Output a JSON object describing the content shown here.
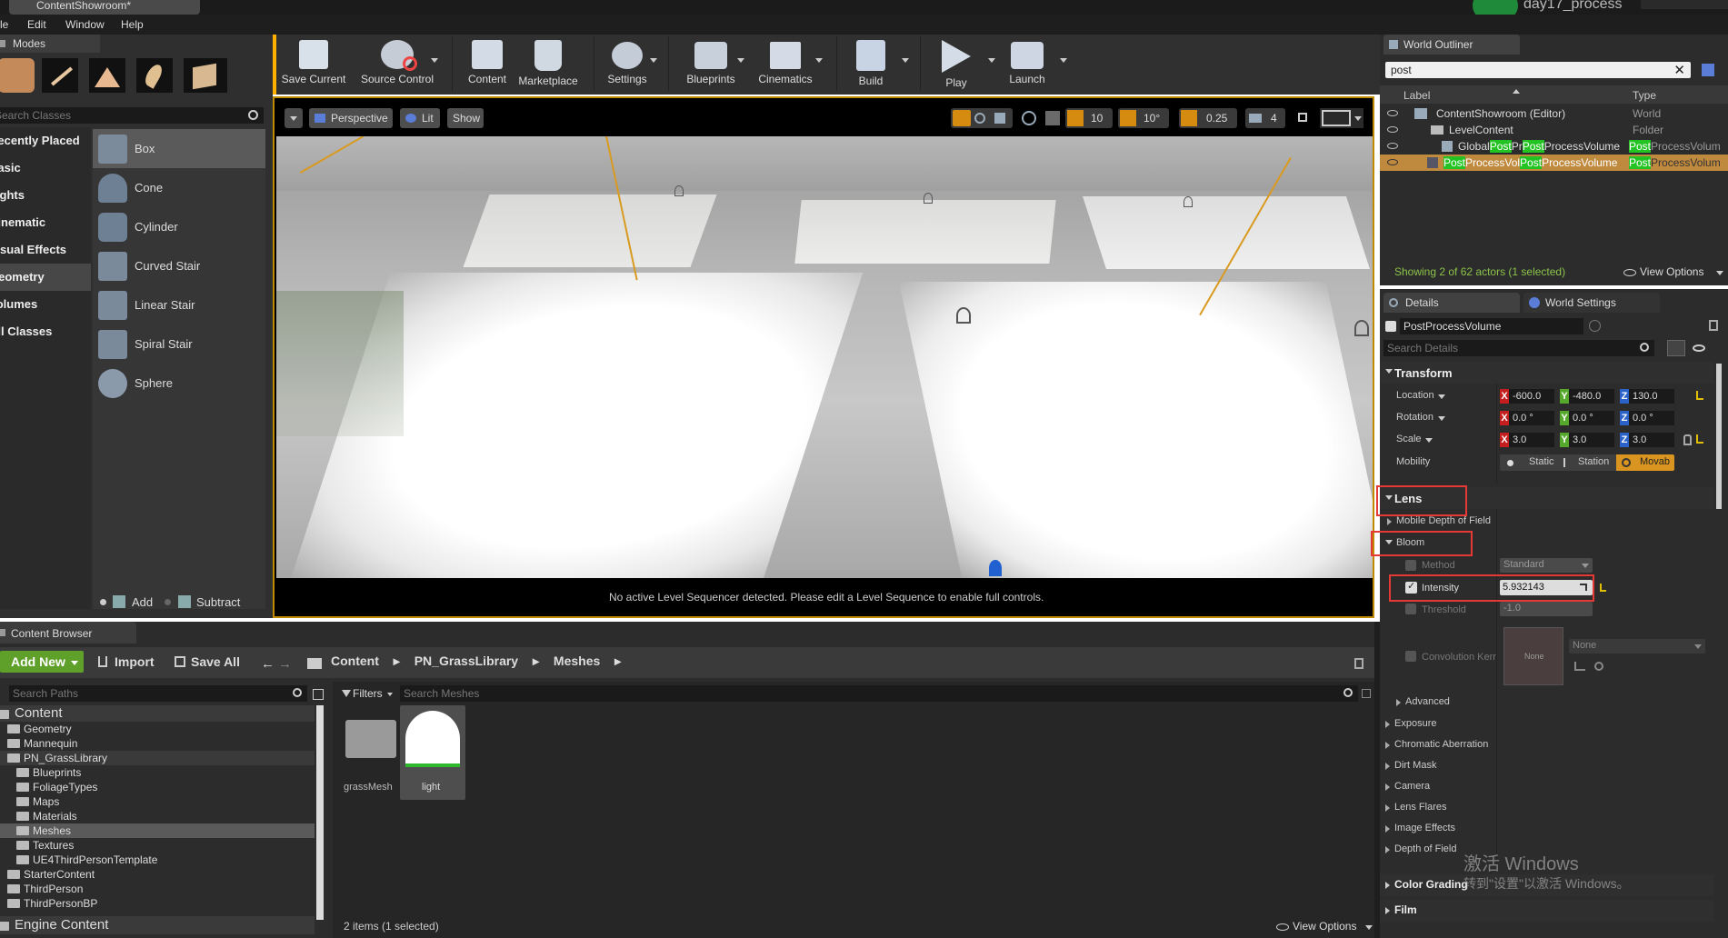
{
  "app": {
    "project_tab": "ContentShowroom*",
    "project_name": "day17_process"
  },
  "menu": [
    "File",
    "Edit",
    "Window",
    "Help"
  ],
  "modes": {
    "tab": "Modes",
    "search_placeholder": "Search Classes",
    "categories": [
      "Recently Placed",
      "Basic",
      "Lights",
      "Cinematic",
      "Visual Effects",
      "Geometry",
      "Volumes",
      "All Classes"
    ],
    "items": [
      "Box",
      "Cone",
      "Cylinder",
      "Curved Stair",
      "Linear Stair",
      "Spiral Stair",
      "Sphere"
    ],
    "add_label": "Add",
    "subtract_label": "Subtract"
  },
  "toolbar": {
    "buttons": [
      "Save Current",
      "Source Control",
      "Content",
      "Marketplace",
      "Settings",
      "Blueprints",
      "Cinematics",
      "Build",
      "Play",
      "Launch"
    ]
  },
  "viewport": {
    "perspective": "Perspective",
    "lit": "Lit",
    "show": "Show",
    "grid_snap": "10",
    "rot_snap": "10°",
    "scale_snap": "0.25",
    "cam_speed": "4",
    "sequencer_msg": "No active Level Sequencer detected. Please edit a Level Sequence to enable full controls."
  },
  "outliner": {
    "tab": "World Outliner",
    "search_value": "post",
    "col_label": "Label",
    "col_type": "Type",
    "rows": [
      {
        "label": "ContentShowroom (Editor)",
        "type": "World"
      },
      {
        "label": "LevelContent",
        "type": "Folder"
      },
      {
        "label_a": "Global",
        "label_b": "Post",
        "label_c": "Pr",
        "label_d": "Post",
        "label_e": "ProcessVolume",
        "type_a": "Post",
        "type_b": "ProcessVolum"
      },
      {
        "label_a": "Post",
        "label_b": "ProcessVol",
        "label_c": "Post",
        "label_d": "ProcessVolume",
        "type_a": "Post",
        "type_b": "ProcessVolum"
      }
    ],
    "status": "Showing 2 of 62 actors (1 selected)",
    "view_options": "View Options"
  },
  "details": {
    "tab_details": "Details",
    "tab_world": "World Settings",
    "actor_name": "PostProcessVolume",
    "search_placeholder": "Search Details",
    "transform": "Transform",
    "location_label": "Location",
    "rotation_label": "Rotation",
    "scale_label": "Scale",
    "mobility_label": "Mobility",
    "axis_x": "X",
    "axis_y": "Y",
    "axis_z": "Z",
    "location": [
      "-600.0",
      "-480.0",
      "130.0"
    ],
    "rotation": [
      "0.0 °",
      "0.0 °",
      "0.0 °"
    ],
    "scale": [
      "3.0",
      "3.0",
      "3.0"
    ],
    "mobility": [
      "Static",
      "Station",
      "Movab"
    ],
    "lens": "Lens",
    "mobile_dof": "Mobile Depth of Field",
    "bloom": "Bloom",
    "method_label": "Method",
    "method_value": "Standard",
    "intensity_label": "Intensity",
    "intensity_value": "5.932143",
    "threshold_label": "Threshold",
    "threshold_value": "-1.0",
    "convolution_label": "Convolution Kerr",
    "convolution_thumb": "None",
    "convolution_value": "None",
    "advanced": "Advanced",
    "sections": [
      "Exposure",
      "Chromatic Aberration",
      "Dirt Mask",
      "Camera",
      "Lens Flares",
      "Image Effects",
      "Depth of Field"
    ],
    "color_grading": "Color Grading",
    "film": "Film"
  },
  "content_browser": {
    "tab": "Content Browser",
    "add_new": "Add New",
    "import": "Import",
    "save_all": "Save All",
    "breadcrumb": [
      "Content",
      "PN_GrassLibrary",
      "Meshes"
    ],
    "search_paths_placeholder": "Search Paths",
    "filters": "Filters",
    "search_meshes_placeholder": "Search Meshes",
    "tree": [
      {
        "label": "Content",
        "depth": 0,
        "big": true
      },
      {
        "label": "Geometry",
        "depth": 1
      },
      {
        "label": "Mannequin",
        "depth": 1
      },
      {
        "label": "PN_GrassLibrary",
        "depth": 1
      },
      {
        "label": "Blueprints",
        "depth": 2
      },
      {
        "label": "FoliageTypes",
        "depth": 2
      },
      {
        "label": "Maps",
        "depth": 2
      },
      {
        "label": "Materials",
        "depth": 2
      },
      {
        "label": "Meshes",
        "depth": 2
      },
      {
        "label": "Textures",
        "depth": 2
      },
      {
        "label": "UE4ThirdPersonTemplate",
        "depth": 2
      },
      {
        "label": "StarterContent",
        "depth": 1
      },
      {
        "label": "ThirdPerson",
        "depth": 1
      },
      {
        "label": "ThirdPersonBP",
        "depth": 1
      }
    ],
    "engine_content": "Engine Content",
    "assets": [
      "grassMesh",
      "light"
    ],
    "item_count": "2 items (1 selected)",
    "view_options": "View Options"
  },
  "watermark": {
    "line1": "激活 Windows",
    "line2": "转到\"设置\"以激活 Windows。"
  }
}
